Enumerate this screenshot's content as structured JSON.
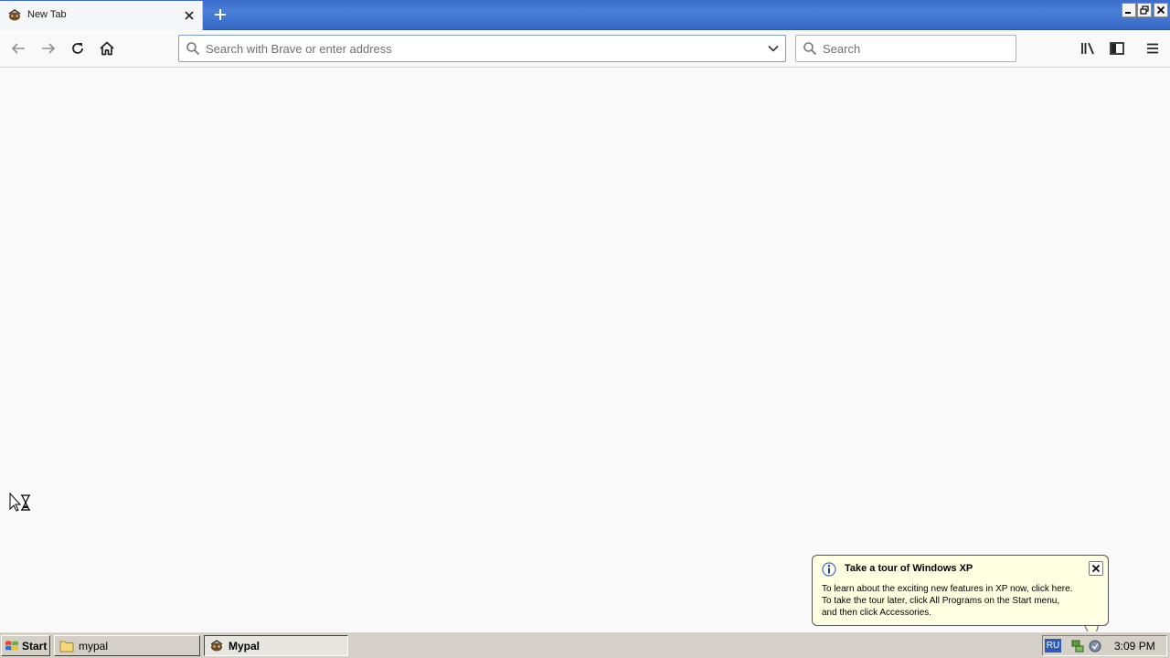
{
  "browser": {
    "tab": {
      "title": "New Tab"
    },
    "urlbar": {
      "placeholder": "Search with Brave or enter address",
      "value": ""
    },
    "searchbar": {
      "placeholder": "Search",
      "value": ""
    }
  },
  "balloon": {
    "title": "Take a tour of Windows XP",
    "lines": [
      "To learn about the exciting new features in XP now, click here.",
      "To take the tour later, click All Programs on the Start menu,",
      "and then click Accessories."
    ]
  },
  "taskbar": {
    "start_label": "Start",
    "buttons": [
      {
        "label": "mypal",
        "icon": "folder-icon"
      },
      {
        "label": "Mypal",
        "icon": "mypal-icon"
      }
    ],
    "tray": {
      "language": "RU",
      "clock": "3:09 PM"
    }
  },
  "colors": {
    "tabstrip": "#3b6ccb",
    "urlbar_border": "#7a9cd3",
    "balloon_bg": "#ffffe1",
    "taskbar_bg": "#d4d0c8"
  }
}
